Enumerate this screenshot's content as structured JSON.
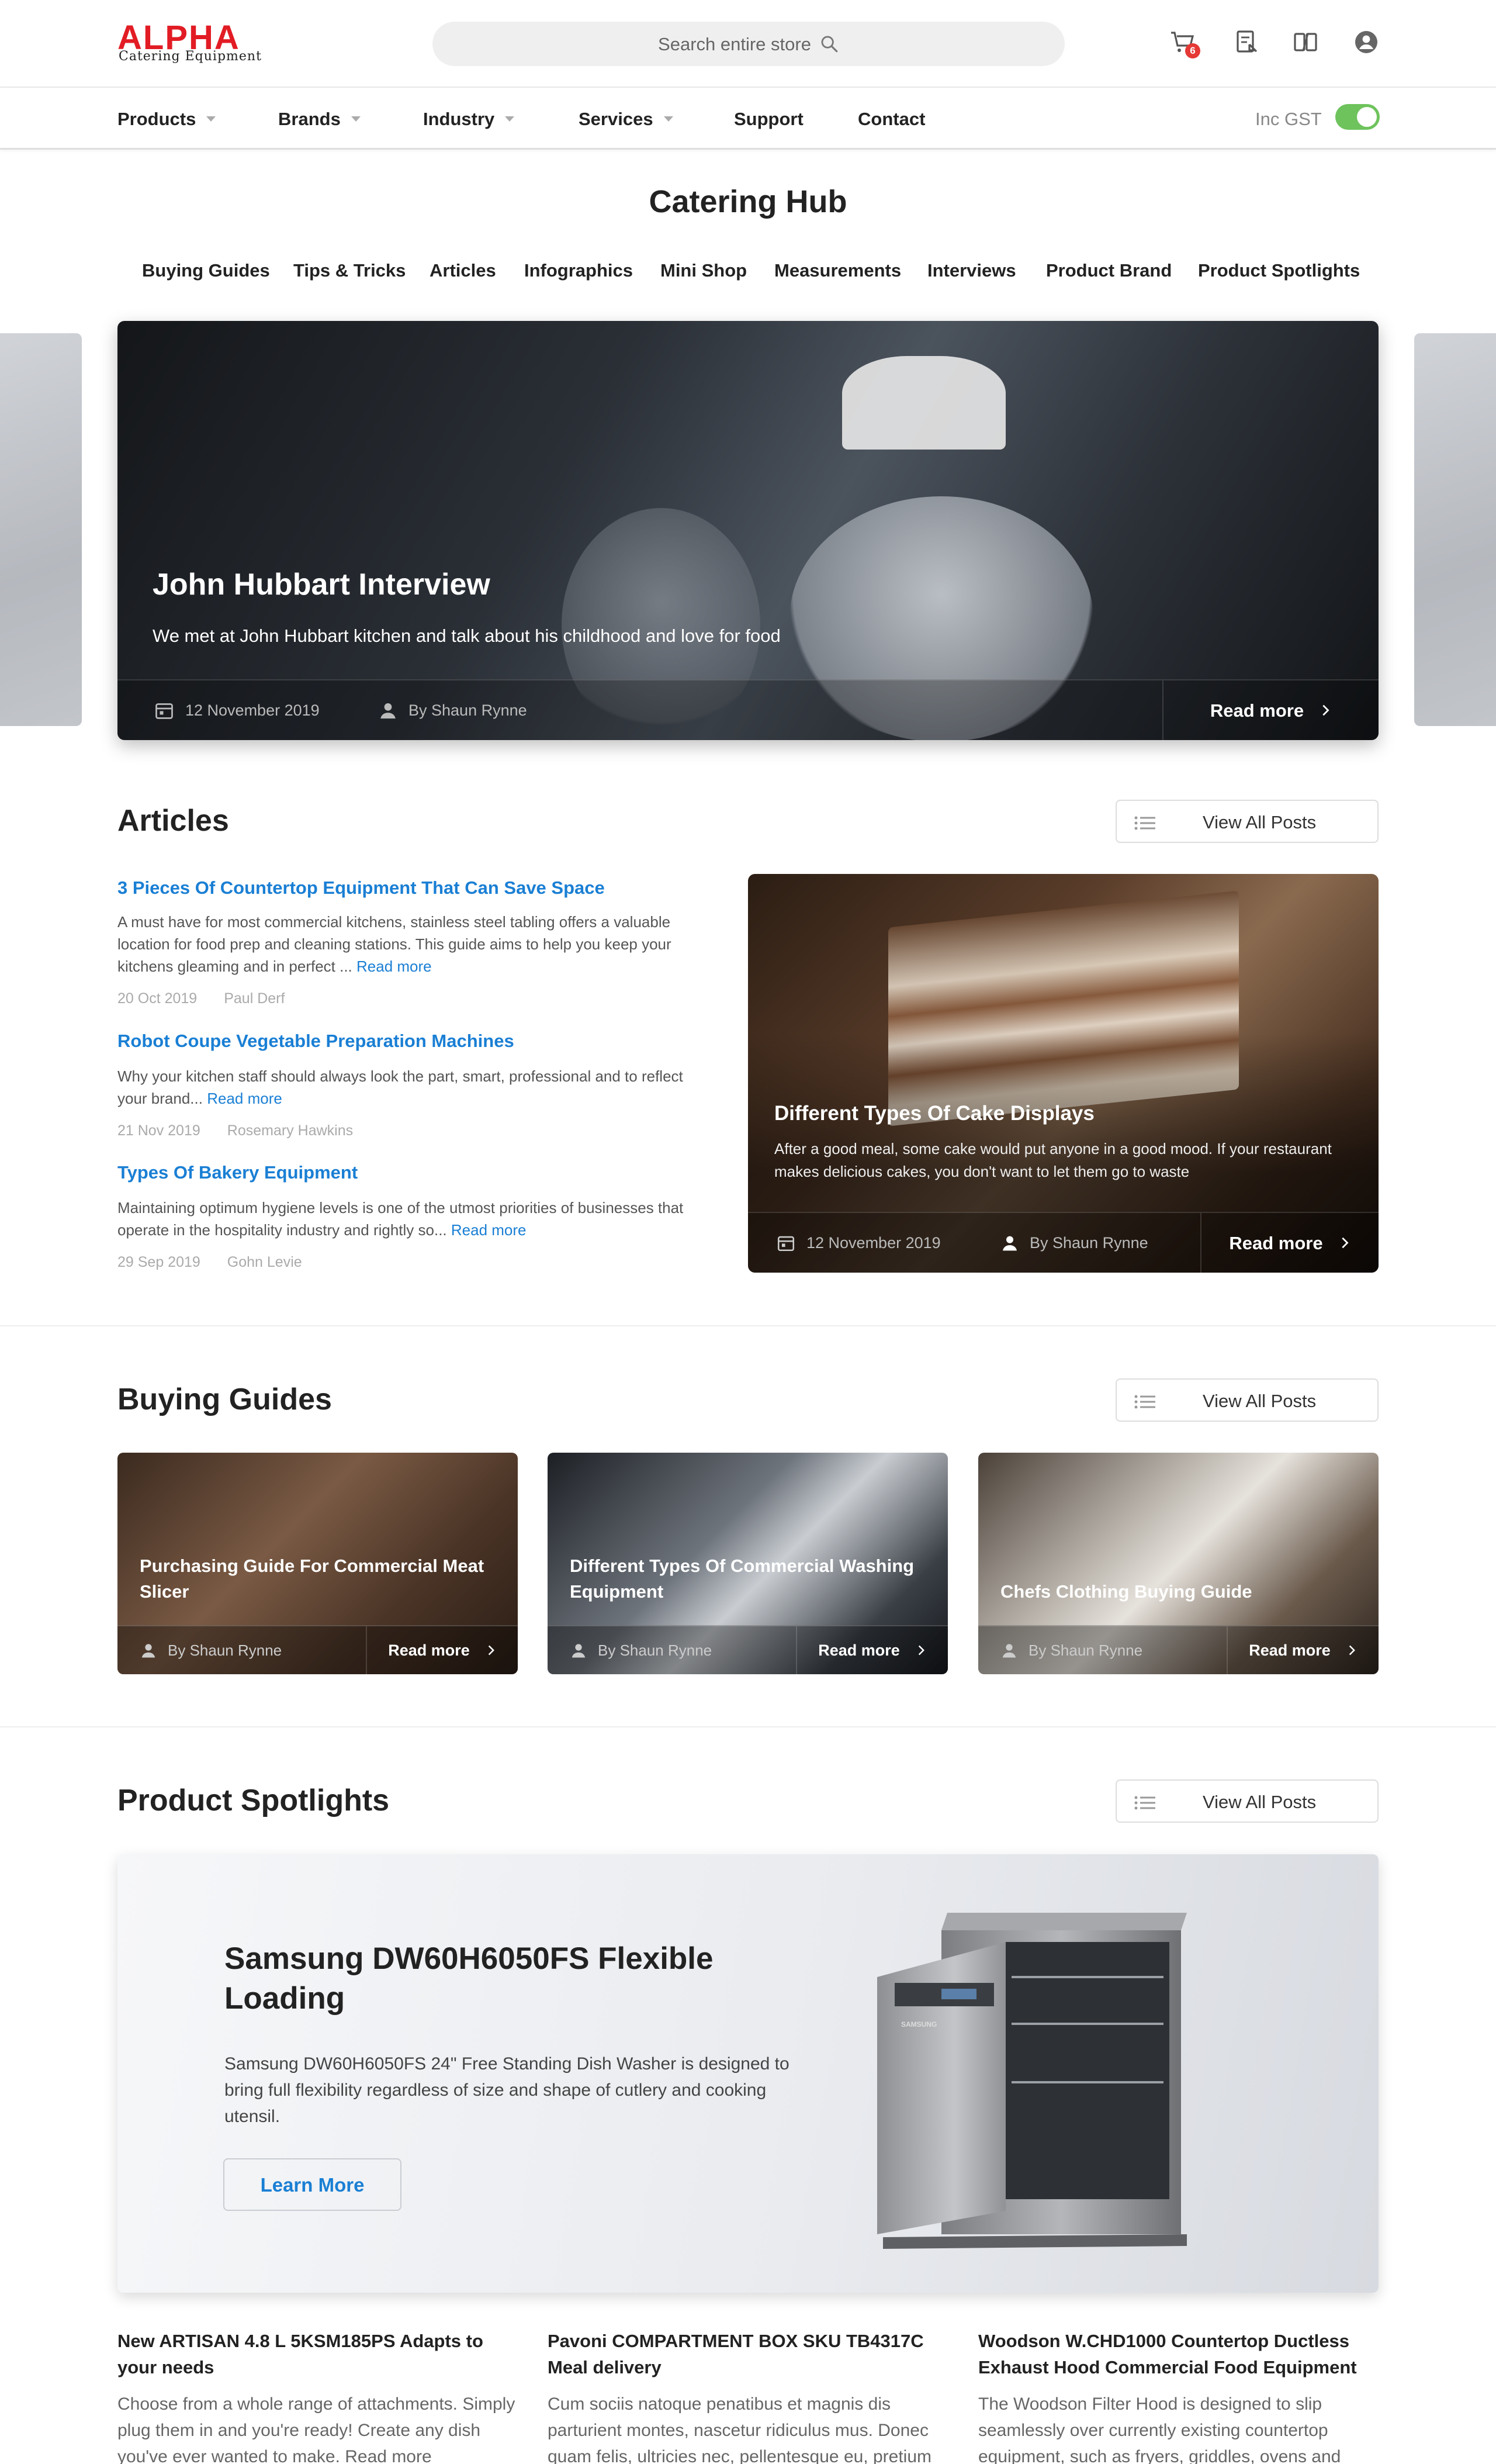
{
  "brand": {
    "name": "ALPHA",
    "tagline": "Catering Equipment",
    "color": "#e21c24"
  },
  "search": {
    "placeholder": "Search entire store"
  },
  "header_icons": [
    {
      "name": "cart-icon",
      "badge": "6"
    },
    {
      "name": "quote-icon"
    },
    {
      "name": "compare-icon"
    },
    {
      "name": "account-icon"
    }
  ],
  "nav": {
    "items": [
      "Products",
      "Brands",
      "Industry",
      "Services",
      "Support",
      "Contact"
    ],
    "gst_label": "Inc GST",
    "gst_on": true
  },
  "hub": {
    "title": "Catering Hub",
    "tabs": [
      "Buying Guides",
      "Tips & Tricks",
      "Articles",
      "Infographics",
      "Mini Shop",
      "Measurements",
      "Interviews",
      "Product Brand",
      "Product Spotlights"
    ]
  },
  "hero": {
    "title": "John Hubbart Interview",
    "desc": "We met at  John Hubbart kitchen and talk about his childhood and love for food",
    "date": "12 November 2019",
    "author": "By Shaun Rynne",
    "read_more": "Read more"
  },
  "articles": {
    "title": "Articles",
    "view_all": "View All Posts",
    "items": [
      {
        "title": "3 Pieces Of Countertop Equipment That Can Save Space",
        "desc": "A must have for most commercial kitchens, stainless steel tabling offers a valuable location for food prep and cleaning stations. This guide aims to help you keep your kitchens gleaming and in perfect ...",
        "read_more": "Read more",
        "date": "20 Oct 2019",
        "author": "Paul Derf"
      },
      {
        "title": "Robot Coupe Vegetable Preparation Machines",
        "desc": "Why your kitchen staff should always look the part, smart, professional and to reflect your brand...",
        "read_more": "Read more",
        "date": "21 Nov 2019",
        "author": "Rosemary Hawkins"
      },
      {
        "title": "Types Of Bakery Equipment",
        "desc": "Maintaining optimum hygiene levels is one of the utmost priorities of businesses that operate in the hospitality industry and rightly so...",
        "read_more": "Read more",
        "date": "29 Sep 2019",
        "author": "Gohn Levie"
      }
    ],
    "featured": {
      "title": "Different Types Of Cake Displays",
      "desc": "After a good meal, some cake would put anyone in a good mood. If your restaurant makes delicious cakes, you don't want to let them go to waste",
      "date": "12 November 2019",
      "author": "By Shaun Rynne",
      "read_more": "Read more"
    }
  },
  "guides": {
    "title": "Buying Guides",
    "view_all": "View All Posts",
    "items": [
      {
        "title": "Purchasing Guide For Commercial Meat Slicer",
        "author": "By Shaun Rynne",
        "read_more": "Read more"
      },
      {
        "title": "Different Types Of Commercial Washing Equipment",
        "author": "By Shaun Rynne",
        "read_more": "Read more"
      },
      {
        "title": "Chefs Clothing Buying Guide",
        "author": "By Shaun Rynne",
        "read_more": "Read more"
      }
    ]
  },
  "spotlights": {
    "title": "Product Spotlights",
    "view_all": "View All Posts",
    "feature": {
      "title": "Samsung DW60H6050FS Flexible Loading",
      "desc": "Samsung DW60H6050FS 24\" Free Standing Dish Washer  is designed to bring full flexibility regardless of size and shape of cutlery and cooking utensil.",
      "button": "Learn More",
      "appliance_label": "SAMSUNG"
    },
    "products": [
      {
        "title": "New ARTISAN 4.8 L 5KSM185PS Adapts to your needs",
        "desc": "Choose from a whole range of attachments. Simply plug them in and you're ready! Create any dish you've ever wanted to make. Read more"
      },
      {
        "title": "Pavoni COMPARTMENT BOX SKU TB4317C Meal delivery",
        "desc": "Cum sociis natoque penatibus et magnis dis parturient montes, nascetur ridiculus mus. Donec quam felis, ultricies nec, pellentesque eu, pretium quis."
      },
      {
        "title": "Woodson W.CHD1000 Countertop Ductless Exhaust Hood Commercial Food Equipment",
        "desc": "The Woodson Filter Hood is designed to slip seamlessly over currently existing countertop equipment, such as fryers, griddles, ovens and more."
      }
    ]
  }
}
